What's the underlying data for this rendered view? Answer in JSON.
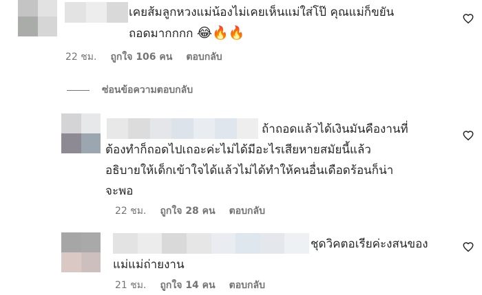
{
  "comments": [
    {
      "text": "เคยส้มลูกหวงแม่น้องไม่เคยเห็นแม่ใส่โป๊ คุณแม่ก็ขยัน\nถอดมากกกก",
      "emoji": "😂🔥🔥",
      "time": "22 ชม.",
      "likes": "ถูกใจ 106 คน",
      "reply": "ตอบกลับ",
      "avatar_colors": [
        "#c4c4c4",
        "#e2e2e2",
        "#a9aca8",
        "#d6d6d6"
      ],
      "name_colors": [
        "#e3e3e3",
        "#ededed",
        "#d9d9d9"
      ]
    },
    {
      "text": "ถ้าถอดแล้วได้เงินมันคืองานที่\nต้องทำก็ถอดไปเถอะค่ะไม่ได้มีอะไรเสียหายสมัยนี้แล้ว\nอธิบายให้เด็กเข้าใจได้แล้วไม่ได้ทำให้คนอื่นเดือดร้อนก็น่า\nจะพอ",
      "emoji": "",
      "time": "22 ชม.",
      "likes": "ถูกใจ 28 คน",
      "reply": "ตอบกลับ",
      "avatar_colors": [
        "#d4d4d6",
        "#e6e8ea",
        "#8d8a93",
        "#9aa6b0"
      ],
      "name_colors": [
        "#e8e8e8",
        "#dcdcdc",
        "#e4e6ea",
        "#dce3ea",
        "#e9ecf1",
        "#dfe6ee",
        "#eeeeee"
      ]
    },
    {
      "text": "ชุดวิคตอเรียค่ะงสนของ\nแม่แม่ถ่ายงาน",
      "emoji": "",
      "time": "21 ชม.",
      "likes": "ถูกใจ 14 คน",
      "reply": "ตอบกลับ",
      "avatar_colors": [
        "#a6a6a6",
        "#a9a9a9",
        "#d9c8c4",
        "#cdbfbd"
      ],
      "name_colors": [
        "#e3e3e3",
        "#ececec",
        "#d9d9d9",
        "#e6e6e6",
        "#e9edf2",
        "#dee6ee",
        "#e4e7ec",
        "#eef1f4"
      ]
    }
  ],
  "hide_replies": "ซ่อนข้อความตอบกลับ",
  "icons": {
    "like": "heart-outline-icon"
  }
}
